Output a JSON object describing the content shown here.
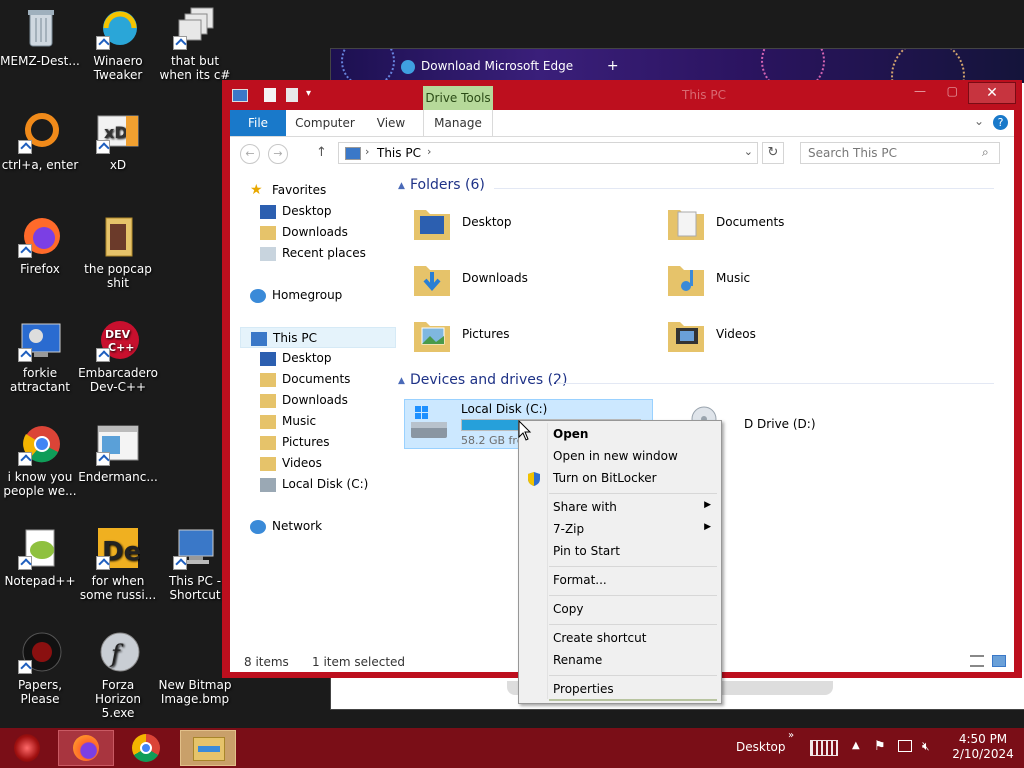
{
  "desktop_icons": [
    {
      "label": "MEMZ-Dest...",
      "icon": "recycle-bin-icon"
    },
    {
      "label": "Winaero Tweaker",
      "icon": "winaero-icon"
    },
    {
      "label": "that but when its c#",
      "icon": "windows-stack-icon"
    },
    {
      "label": "ctrl+a, enter",
      "icon": "orange-ring-icon"
    },
    {
      "label": "xD",
      "icon": "hxd-icon"
    },
    {
      "label": "Firefox",
      "icon": "firefox-icon"
    },
    {
      "label": "the popcap shit",
      "icon": "folder-icon"
    },
    {
      "label": "forkie attractant",
      "icon": "monitor-gear-icon"
    },
    {
      "label": "Embarcadero Dev-C++",
      "icon": "devcpp-icon"
    },
    {
      "label": "i know you people we...",
      "icon": "chrome-icon"
    },
    {
      "label": "Endermanc...",
      "icon": "window-icon"
    },
    {
      "label": "Notepad++",
      "icon": "notepadpp-icon"
    },
    {
      "label": "for when some russi...",
      "icon": "de-icon"
    },
    {
      "label": "This PC - Shortcut",
      "icon": "computer-icon"
    },
    {
      "label": "Papers, Please",
      "icon": "papers-please-icon"
    },
    {
      "label": "Forza Horizon 5.exe",
      "icon": "flash-icon"
    },
    {
      "label": "New Bitmap Image.bmp",
      "icon": "bitmap-icon"
    }
  ],
  "edge_window": {
    "tab_title": "Download Microsoft Edge"
  },
  "explorer": {
    "drive_tools": "Drive Tools",
    "title": "This PC",
    "tabs": [
      "File",
      "Computer",
      "View",
      "Manage"
    ],
    "address": "This PC",
    "search_placeholder": "Search This PC",
    "nav": {
      "favorites": "Favorites",
      "fav_items": [
        "Desktop",
        "Downloads",
        "Recent places"
      ],
      "homegroup": "Homegroup",
      "this_pc": "This PC",
      "pc_items": [
        "Desktop",
        "Documents",
        "Downloads",
        "Music",
        "Pictures",
        "Videos",
        "Local Disk (C:)"
      ],
      "network": "Network"
    },
    "folders_header": "Folders (6)",
    "folders": [
      "Desktop",
      "Documents",
      "Downloads",
      "Music",
      "Pictures",
      "Videos"
    ],
    "drives_header": "Devices and drives (2)",
    "drive_c": {
      "name": "Local Disk (C:)",
      "free": "58.2 GB fre",
      "used_fraction": 0.55
    },
    "drive_d": {
      "name": "CD Drive (D:)",
      "visible_text": "D Drive (D:)"
    },
    "status_items": "8 items",
    "status_selected": "1 item selected"
  },
  "context_menu": {
    "items": [
      "Open",
      "Open in new window",
      "Turn on BitLocker",
      "Share with",
      "7-Zip",
      "Pin to Start",
      "Format...",
      "Copy",
      "Create shortcut",
      "Rename",
      "Properties"
    ]
  },
  "taskbar": {
    "desktop_label": "Desktop",
    "time": "4:50 PM",
    "date": "2/10/2024"
  },
  "colors": {
    "accent": "#bd0f1e",
    "taskbar": "#7a0e17",
    "selection": "#cce8ff",
    "file_tab": "#1979ca",
    "drive_tools": "#b6d99a"
  }
}
